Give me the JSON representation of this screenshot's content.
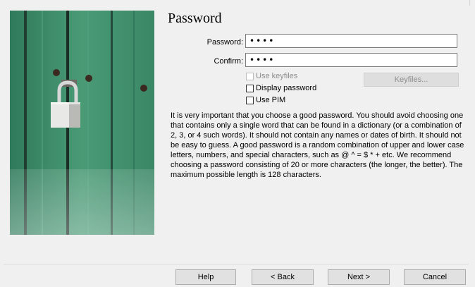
{
  "header": {
    "title": "Password"
  },
  "form": {
    "password_label": "Password:",
    "password_value": "••••",
    "confirm_label": "Confirm:",
    "confirm_value": "••••"
  },
  "options": {
    "use_keyfiles": {
      "label": "Use keyfiles",
      "checked": false,
      "enabled": false
    },
    "display_password": {
      "label": "Display password",
      "checked": false,
      "enabled": true
    },
    "use_pim": {
      "label": "Use PIM",
      "checked": false,
      "enabled": true
    },
    "keyfiles_button": {
      "label": "Keyfiles...",
      "enabled": false
    }
  },
  "info": {
    "text": "It is very important that you choose a good password. You should avoid choosing one that contains only a single word that can be found in a dictionary (or a combination of 2, 3, or 4 such words). It should not contain any names or dates of birth. It should not be easy to guess. A good password is a random combination of upper and lower case letters, numbers, and special characters, such as @ ^ = $ * + etc. We recommend choosing a password consisting of 20 or more characters (the longer, the better). The maximum possible length is 128 characters."
  },
  "footer": {
    "help": "Help",
    "back": "< Back",
    "next": "Next >",
    "cancel": "Cancel"
  },
  "colors": {
    "background": "#f0f0f0",
    "image_green": "#3f8e6b",
    "disabled_text": "#8d8d8d"
  }
}
